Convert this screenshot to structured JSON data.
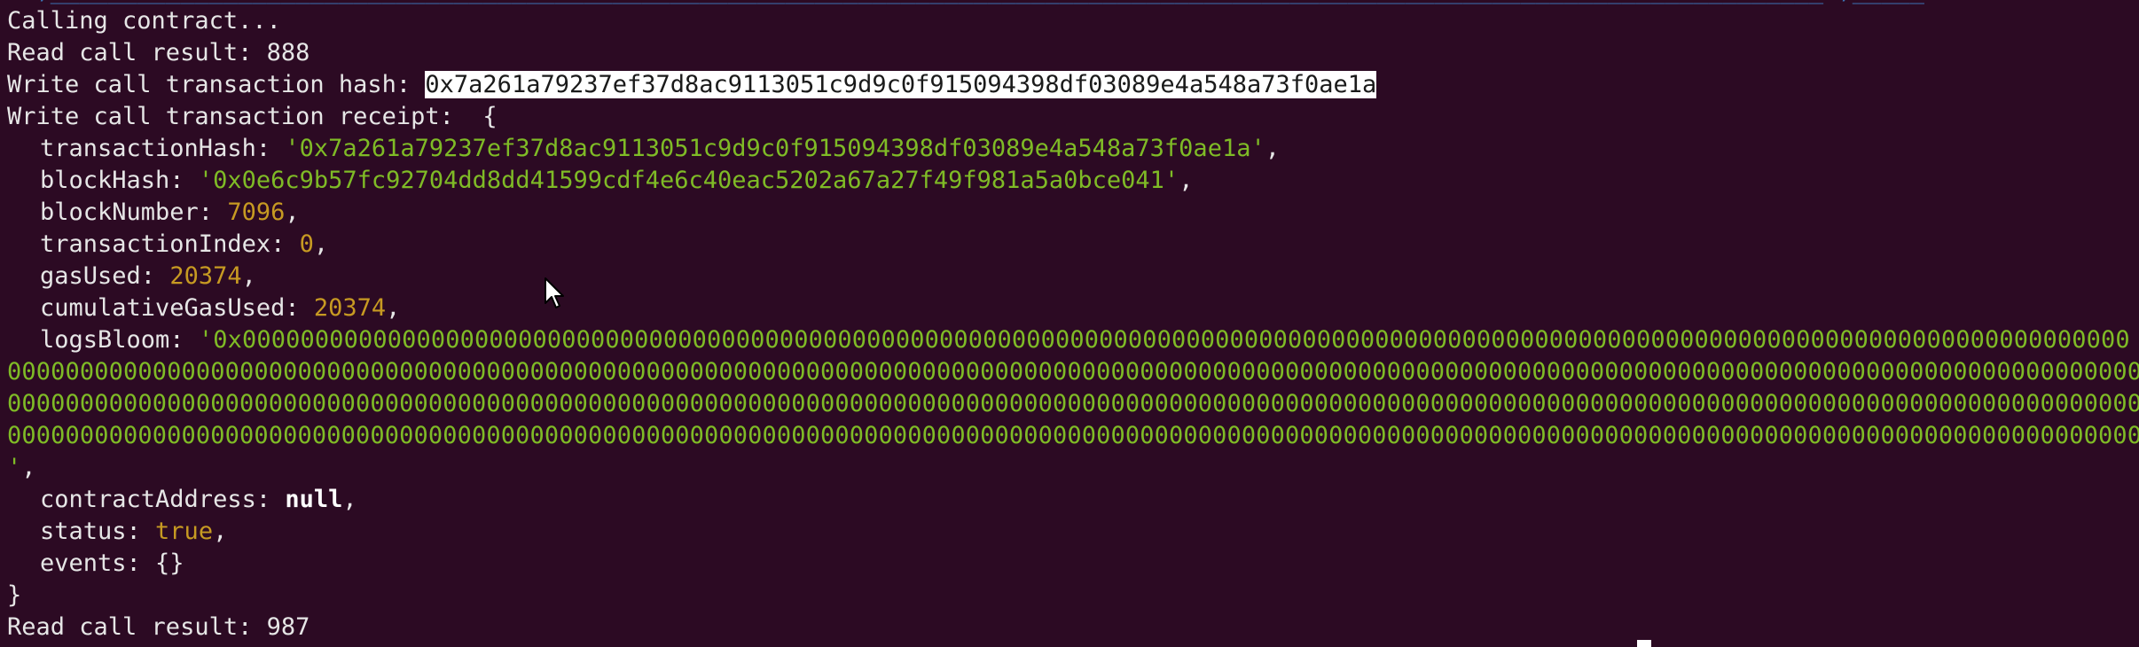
{
  "terminal": {
    "top_partial": "  ,___________________________________________________________________________________________________________________________ ,_____",
    "line_calling": "Calling contract...",
    "read1_label": "Read call result: ",
    "read1_value": "888",
    "hash_label": "Write call transaction hash: ",
    "hash_value": "0x7a261a79237ef37d8ac9113051c9d9c0f915094398df03089e4a548a73f0ae1a",
    "receipt_label": "Write call transaction receipt:  {",
    "tx_hash_key": "transactionHash: ",
    "tx_hash_val": "'0x7a261a79237ef37d8ac9113051c9d9c0f915094398df03089e4a548a73f0ae1a'",
    "block_hash_key": "blockHash: ",
    "block_hash_val": "'0x0e6c9b57fc92704dd8dd41599cdf4e6c40eac5202a67a27f49f981a5a0bce041'",
    "block_number_key": "blockNumber: ",
    "block_number_val": "7096",
    "tx_index_key": "transactionIndex: ",
    "tx_index_val": "0",
    "gas_used_key": "gasUsed: ",
    "gas_used_val": "20374",
    "cum_gas_key": "cumulativeGasUsed: ",
    "cum_gas_val": "20374",
    "logs_bloom_key": "logsBloom: ",
    "logs_bloom_line1": "'0x0000000000000000000000000000000000000000000000000000000000000000000000000000000000000000000000000000000000000000000000000000000000",
    "logs_bloom_line2": "00000000000000000000000000000000000000000000000000000000000000000000000000000000000000000000000000000000000000000000000000000000000000000000000000000000",
    "logs_bloom_line3": "00000000000000000000000000000000000000000000000000000000000000000000000000000000000000000000000000000000000000000000000000000000000000000000000000000000",
    "logs_bloom_line4": "00000000000000000000000000000000000000000000000000000000000000000000000000000000000000000000000000000000000000000000000000000000000000000000000000000000",
    "logs_bloom_end": "'",
    "comma": ",",
    "contract_addr_key": "contractAddress: ",
    "contract_addr_val": "null",
    "status_key": "status: ",
    "status_val": "true",
    "events_key": "events: ",
    "events_val": "{}",
    "close_brace": "}",
    "read2_label": "Read call result: ",
    "read2_value": "987"
  },
  "colors": {
    "background": "#2c0a23",
    "text": "#e6e6e6",
    "string": "#7fbb26",
    "number": "#c79a22",
    "selection_bg": "#ffffff",
    "selection_fg": "#1a1a1a"
  },
  "icons": {
    "mouse_pointer": "arrow-pointer-icon"
  }
}
